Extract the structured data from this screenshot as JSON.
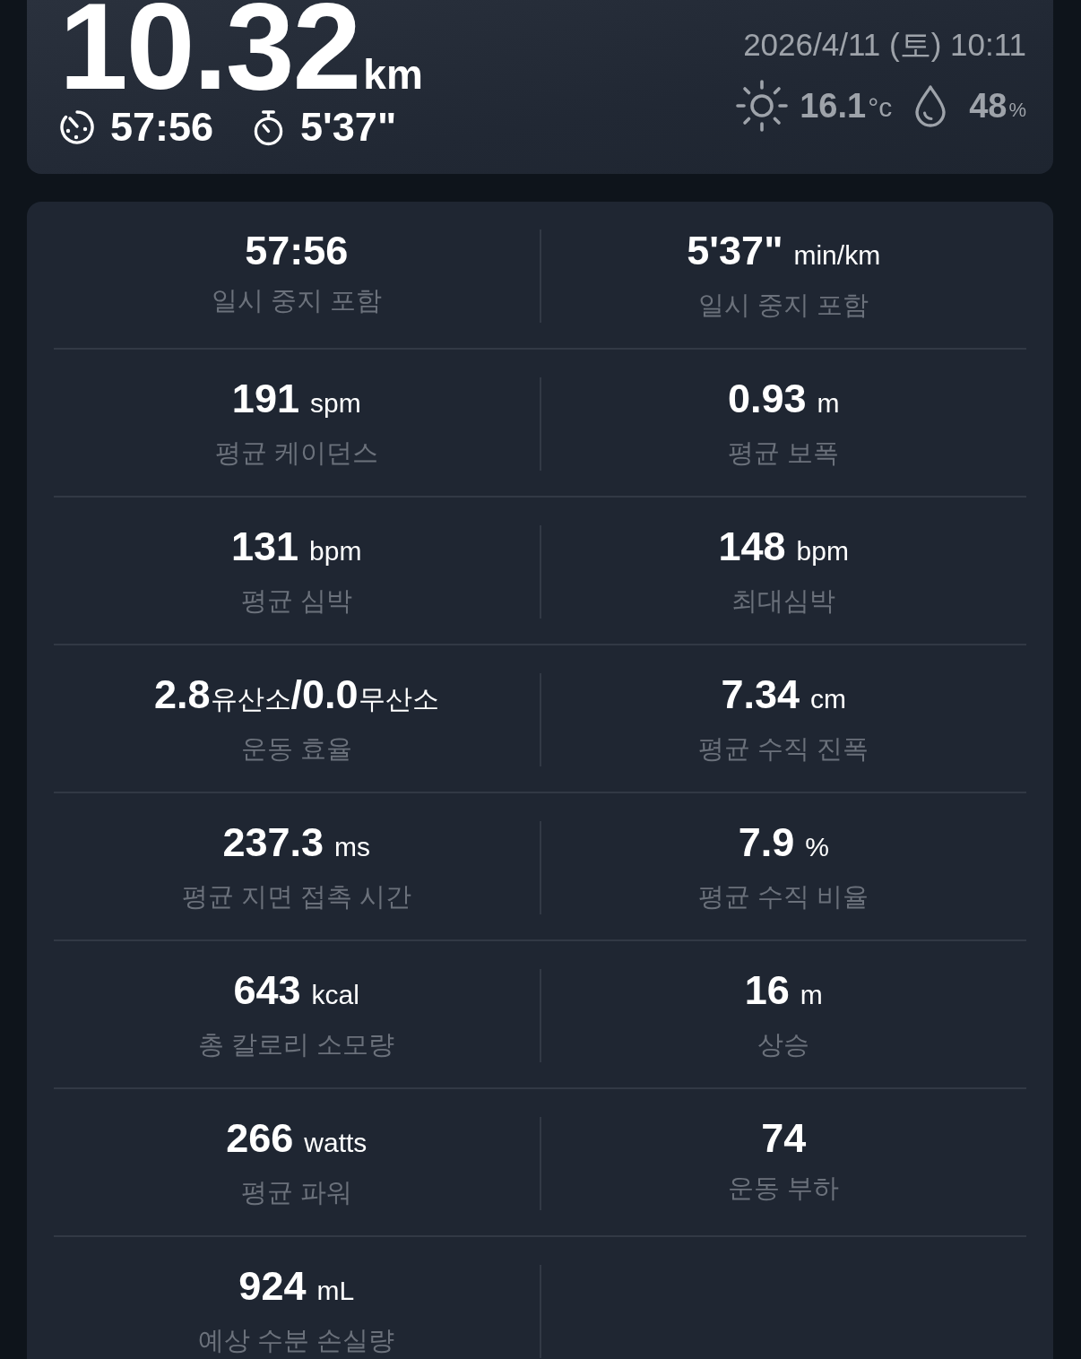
{
  "summary": {
    "distance": {
      "value": "10.32",
      "unit": "km"
    },
    "stats": [
      {
        "kind": "duration",
        "value": "57:56"
      },
      {
        "kind": "pace",
        "value": "5'37\""
      }
    ],
    "date": "2026/4/11 (토) 10:11",
    "weather": {
      "temperature": {
        "value": "16.1",
        "unit": "°c"
      },
      "humidity": {
        "value": "48",
        "unit": "%"
      }
    }
  },
  "metrics": [
    {
      "kind": "measure",
      "value": "57:56",
      "label": "일시 중지 포함"
    },
    {
      "kind": "measure",
      "value": "5'37\"",
      "unit": "min/km",
      "label": "일시 중지 포함"
    },
    {
      "kind": "measure",
      "value": "191",
      "unit": "spm",
      "label": "평균 케이던스"
    },
    {
      "kind": "measure",
      "value": "0.93",
      "unit": "m",
      "label": "평균 보폭"
    },
    {
      "kind": "measure",
      "value": "131",
      "unit": "bpm",
      "label": "평균 심박"
    },
    {
      "kind": "measure",
      "value": "148",
      "unit": "bpm",
      "label": "최대심박"
    },
    {
      "kind": "ratio",
      "value": "**2.8**유산소**/0.0**무산소",
      "label": "운동 효율"
    },
    {
      "kind": "measure",
      "value": "7.34",
      "unit": "cm",
      "label": "평균 수직 진폭"
    },
    {
      "kind": "measure",
      "value": "237.3",
      "unit": "ms",
      "label": "평균 지면 접촉 시간"
    },
    {
      "kind": "measure",
      "value": "7.9",
      "unit": "%",
      "label": "평균 수직 비율"
    },
    {
      "kind": "measure",
      "value": "643",
      "unit": "kcal",
      "label": "총 칼로리 소모량"
    },
    {
      "kind": "measure",
      "value": "16",
      "unit": "m",
      "label": "상승"
    },
    {
      "kind": "measure",
      "value": "266",
      "unit": "watts",
      "label": "평균 파워"
    },
    {
      "kind": "measure",
      "value": "74",
      "label": "운동 부하"
    },
    {
      "kind": "measure",
      "value": "924",
      "unit": "mL",
      "label": "예상 수분 손실량"
    }
  ]
}
